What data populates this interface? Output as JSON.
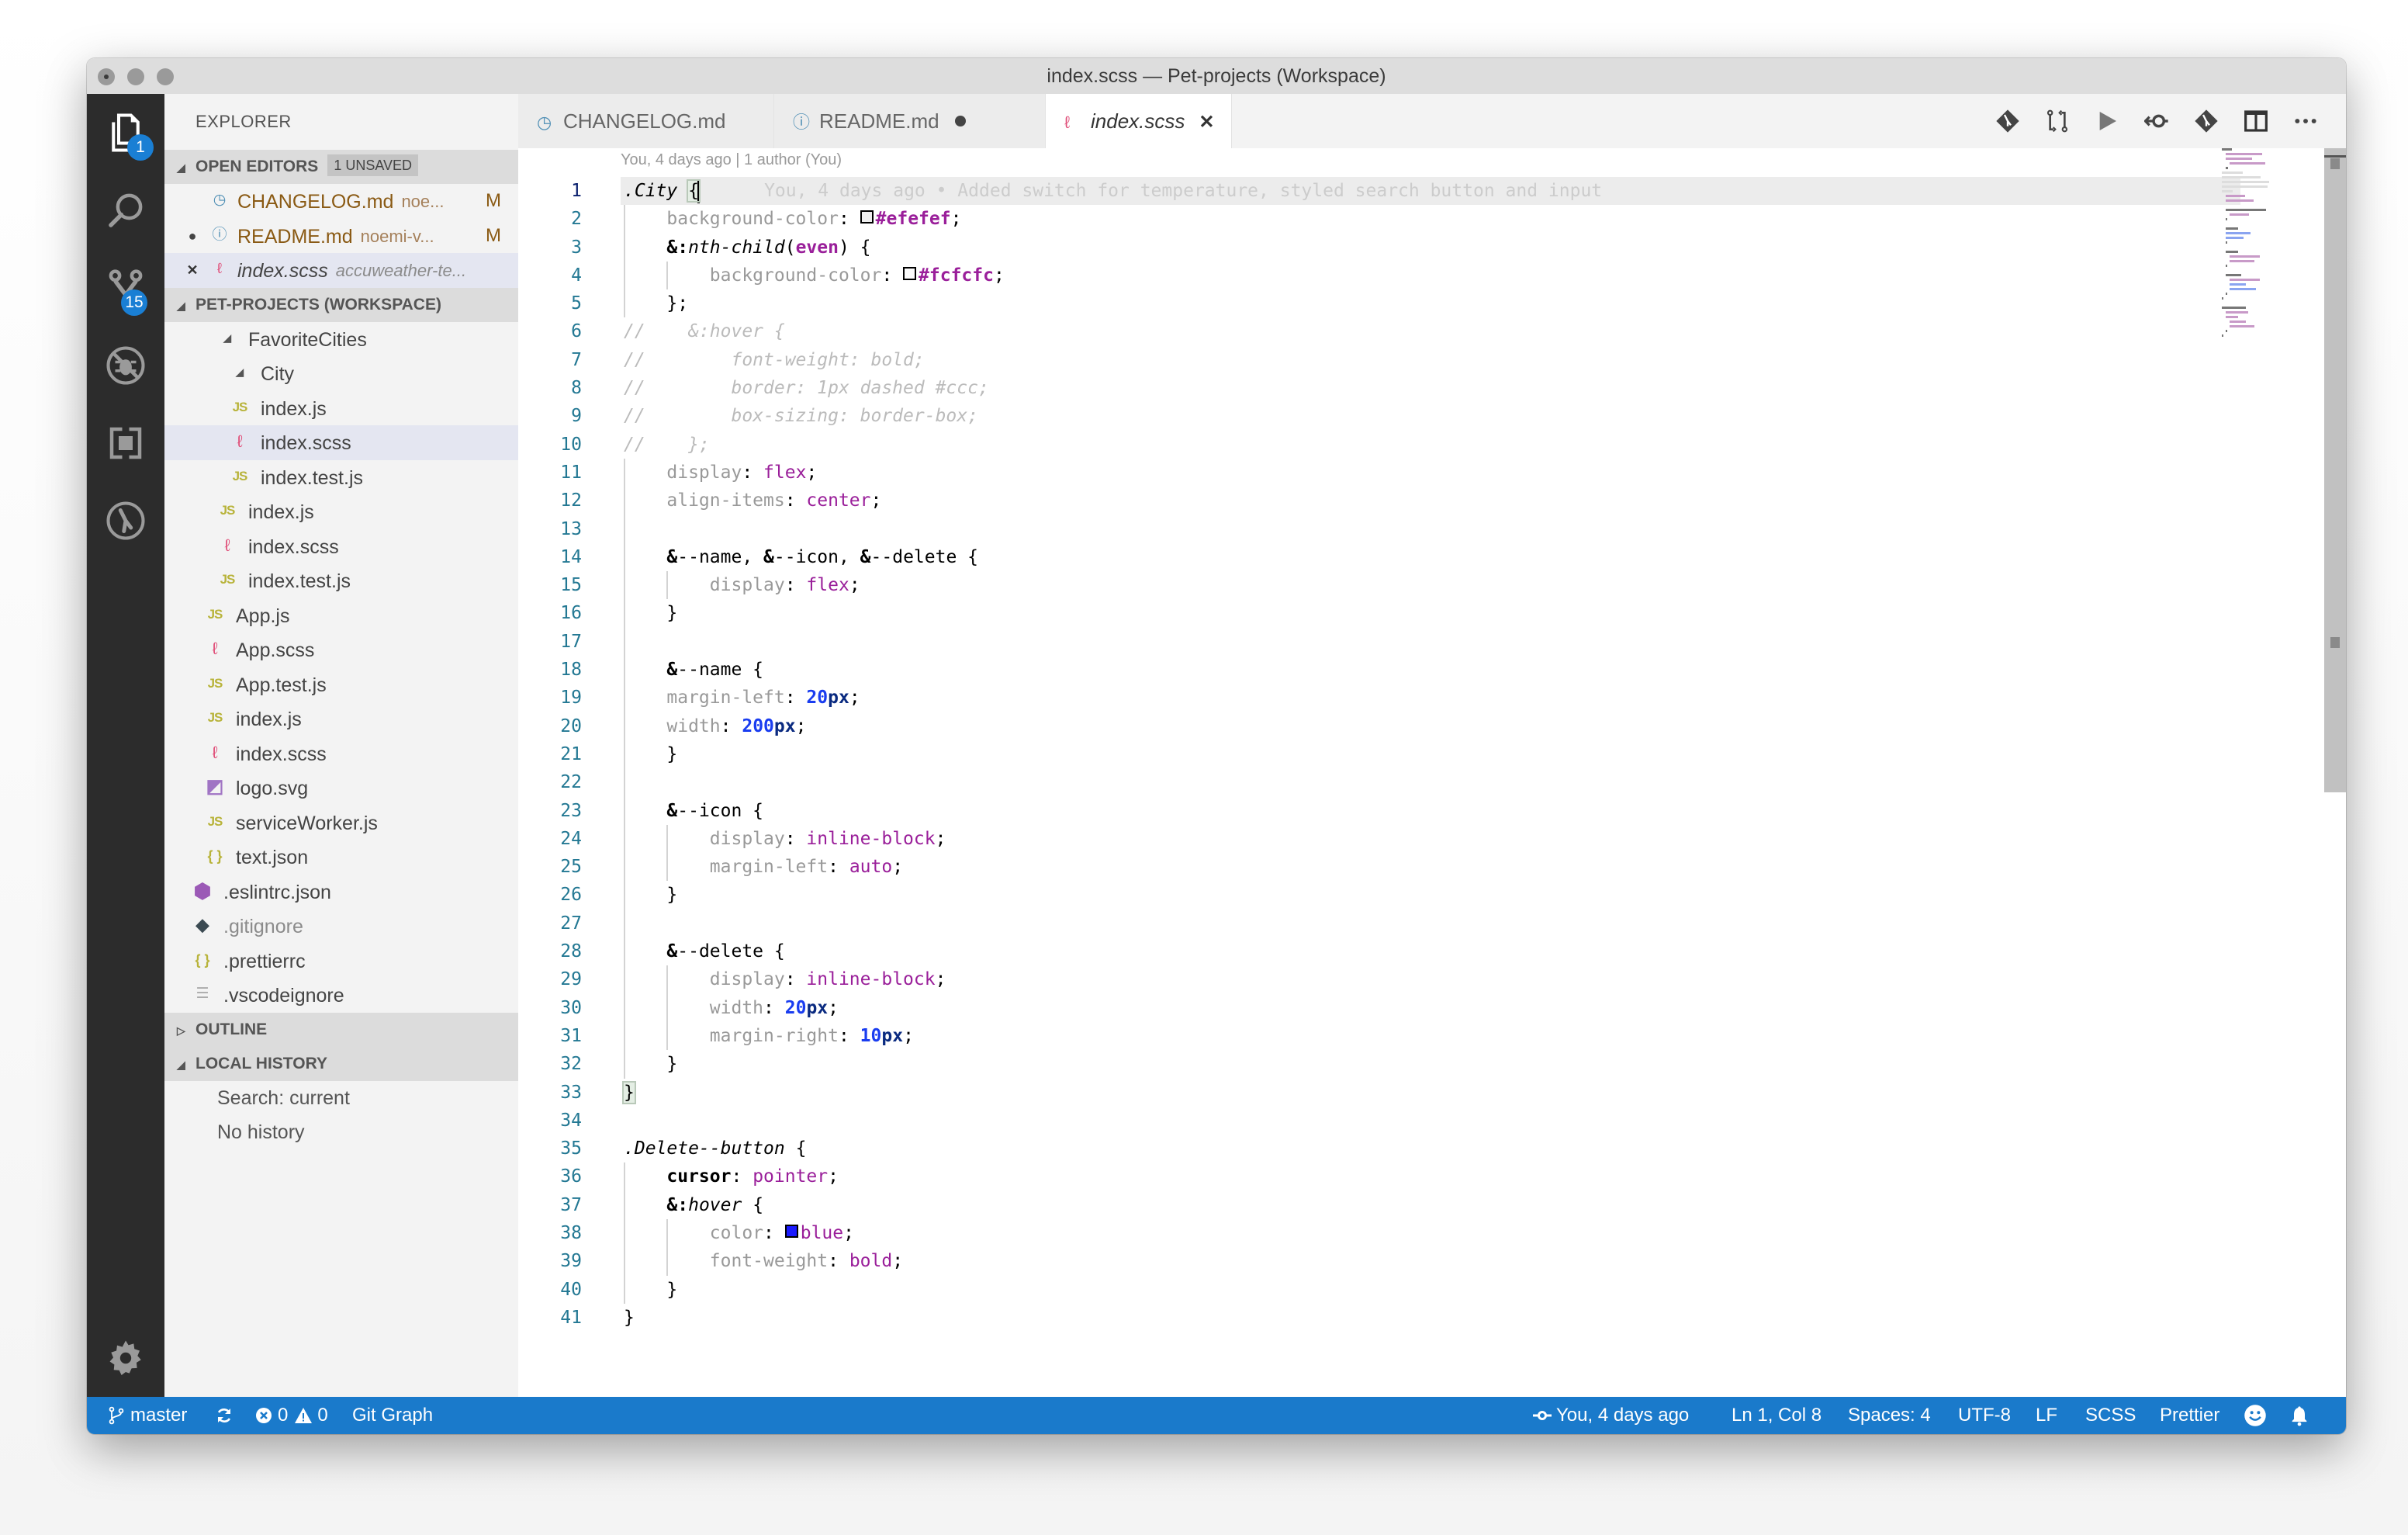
{
  "window": {
    "title": "index.scss — Pet-projects (Workspace)"
  },
  "activity_bar": {
    "items": [
      {
        "name": "explorer",
        "icon": "files-icon",
        "badge": "1"
      },
      {
        "name": "search",
        "icon": "search-icon"
      },
      {
        "name": "source-control",
        "icon": "source-control-icon",
        "badge": "15"
      },
      {
        "name": "debug",
        "icon": "debug-icon"
      },
      {
        "name": "extensions",
        "icon": "extensions-icon"
      },
      {
        "name": "git-lens",
        "icon": "gitlens-icon"
      }
    ],
    "settings_icon": "gear-icon"
  },
  "sidebar": {
    "title": "EXPLORER",
    "open_editors": {
      "label": "OPEN EDITORS",
      "badge": "1 UNSAVED",
      "items": [
        {
          "name": "CHANGELOG.md",
          "desc": "noe...",
          "flag": "M",
          "icon": "clock-icon",
          "lead": ""
        },
        {
          "name": "README.md",
          "desc": "noemi-v...",
          "flag": "M",
          "icon": "info-icon",
          "lead": "●"
        },
        {
          "name": "index.scss",
          "desc": "accuweather-te...",
          "flag": "",
          "icon": "sass-icon",
          "lead": "✕"
        }
      ]
    },
    "workspace": {
      "label": "PET-PROJECTS (WORKSPACE)",
      "items": [
        {
          "name": "FavoriteCities",
          "type": "folder",
          "depth": 3
        },
        {
          "name": "City",
          "type": "folder",
          "depth": 4
        },
        {
          "name": "index.js",
          "type": "js",
          "depth": 5
        },
        {
          "name": "index.scss",
          "type": "scss",
          "depth": 5,
          "selected": true
        },
        {
          "name": "index.test.js",
          "type": "js",
          "depth": 5
        },
        {
          "name": "index.js",
          "type": "js",
          "depth": 4
        },
        {
          "name": "index.scss",
          "type": "scss",
          "depth": 4
        },
        {
          "name": "index.test.js",
          "type": "js",
          "depth": 4
        },
        {
          "name": "App.js",
          "type": "js",
          "depth": 3
        },
        {
          "name": "App.scss",
          "type": "scss",
          "depth": 3
        },
        {
          "name": "App.test.js",
          "type": "js",
          "depth": 3
        },
        {
          "name": "index.js",
          "type": "js",
          "depth": 3
        },
        {
          "name": "index.scss",
          "type": "scss",
          "depth": 3
        },
        {
          "name": "logo.svg",
          "type": "svg",
          "depth": 3
        },
        {
          "name": "serviceWorker.js",
          "type": "js",
          "depth": 3
        },
        {
          "name": "text.json",
          "type": "json",
          "depth": 3
        },
        {
          "name": ".eslintrc.json",
          "type": "eslint",
          "depth": 2
        },
        {
          "name": ".gitignore",
          "type": "git",
          "depth": 2,
          "dimmed": true
        },
        {
          "name": ".prettierrc",
          "type": "json",
          "depth": 2
        },
        {
          "name": ".vscodeignore",
          "type": "text",
          "depth": 2
        }
      ]
    },
    "outline": {
      "label": "OUTLINE"
    },
    "local_history": {
      "label": "LOCAL HISTORY",
      "items": [
        "Search: current",
        "No history"
      ]
    }
  },
  "tabs": [
    {
      "label": "CHANGELOG.md",
      "icon": "clock-icon",
      "active": false
    },
    {
      "label": "README.md",
      "icon": "info-icon",
      "active": false,
      "dirty": true
    },
    {
      "label": "index.scss",
      "icon": "sass-icon",
      "active": true
    }
  ],
  "editor_actions": [
    "git-compare-icon",
    "pull-request-icon",
    "run-icon",
    "open-changes-icon",
    "git-icon",
    "split-editor-icon",
    "more-icon"
  ],
  "editor": {
    "blame_header": "You, 4 days ago | 1 author (You)",
    "inline_blame": "You, 4 days ago • Added switch for temperature, styled search button and input",
    "lines": [
      ".City {",
      "    background-color: #efefef;",
      "    &:nth-child(even) {",
      "        background-color: #fcfcfc;",
      "    };",
      "//    &:hover {",
      "//        font-weight: bold;",
      "//        border: 1px dashed #ccc;",
      "//        box-sizing: border-box;",
      "//    };",
      "    display: flex;",
      "    align-items: center;",
      "",
      "    &--name, &--icon, &--delete {",
      "        display: flex;",
      "    }",
      "",
      "    &--name {",
      "    margin-left: 20px;",
      "    width: 200px;",
      "    }",
      "",
      "    &--icon {",
      "        display: inline-block;",
      "        margin-left: auto;",
      "    }",
      "",
      "    &--delete {",
      "        display: inline-block;",
      "        width: 20px;",
      "        margin-right: 10px;",
      "    }",
      "}",
      "",
      ".Delete--button {",
      "    cursor: pointer;",
      "    &:hover {",
      "        color: blue;",
      "        font-weight: bold;",
      "    }",
      "}"
    ],
    "swatch_colors": {
      "efefef": "#efefef",
      "fcfcfc": "#fcfcfc",
      "blue": "#1a1aff"
    }
  },
  "statusbar": {
    "branch": "master",
    "errors": "0",
    "warnings": "0",
    "git_graph": "Git Graph",
    "blame": "You, 4 days ago",
    "cursor_pos": "Ln 1, Col 8",
    "indent": "Spaces: 4",
    "encoding": "UTF-8",
    "eol": "LF",
    "language": "SCSS",
    "formatter": "Prettier"
  },
  "colors": {
    "statusbar_bg": "#1a7acb",
    "activitybar_bg": "#2c2c2c",
    "badge": "#1a7fd4",
    "modified": "#8a5a14"
  }
}
